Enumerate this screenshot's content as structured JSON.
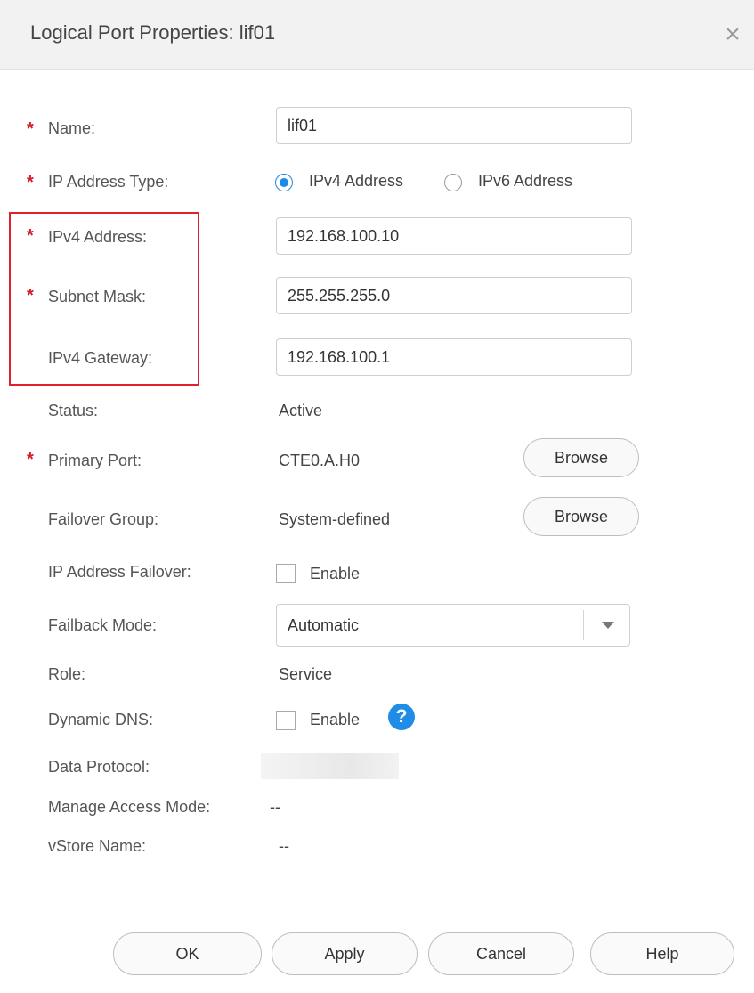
{
  "dialog": {
    "title": "Logical Port Properties: lif01",
    "close_icon": "×"
  },
  "fields": {
    "name": {
      "label": "Name:",
      "value": "lif01"
    },
    "ip_type": {
      "label": "IP Address Type:",
      "options": [
        "IPv4 Address",
        "IPv6 Address"
      ],
      "selected": "IPv4 Address"
    },
    "ipv4_address": {
      "label": "IPv4 Address:",
      "value": "192.168.100.10"
    },
    "subnet_mask": {
      "label": "Subnet Mask:",
      "value": "255.255.255.0"
    },
    "ipv4_gateway": {
      "label": "IPv4 Gateway:",
      "value": "192.168.100.1"
    },
    "status": {
      "label": "Status:",
      "value": "Active"
    },
    "primary_port": {
      "label": "Primary Port:",
      "value": "CTE0.A.H0",
      "button": "Browse"
    },
    "failover_group": {
      "label": "Failover Group:",
      "value": "System-defined",
      "button": "Browse"
    },
    "ip_address_failover": {
      "label": "IP Address Failover:",
      "checkbox_label": "Enable"
    },
    "failback_mode": {
      "label": "Failback Mode:",
      "value": "Automatic"
    },
    "role": {
      "label": "Role:",
      "value": "Service"
    },
    "dynamic_dns": {
      "label": "Dynamic DNS:",
      "checkbox_label": "Enable",
      "help": "?"
    },
    "data_protocol": {
      "label": "Data Protocol:"
    },
    "manage_access_mode": {
      "label": "Manage Access Mode:",
      "value": "--"
    },
    "vstore_name": {
      "label": "vStore Name:",
      "value": "--"
    }
  },
  "required_marker": "*",
  "footer": {
    "ok": "OK",
    "apply": "Apply",
    "cancel": "Cancel",
    "help": "Help"
  },
  "colors": {
    "required": "#d11f2a",
    "highlight_border": "#e0202a",
    "accent": "#1d8ae6"
  }
}
